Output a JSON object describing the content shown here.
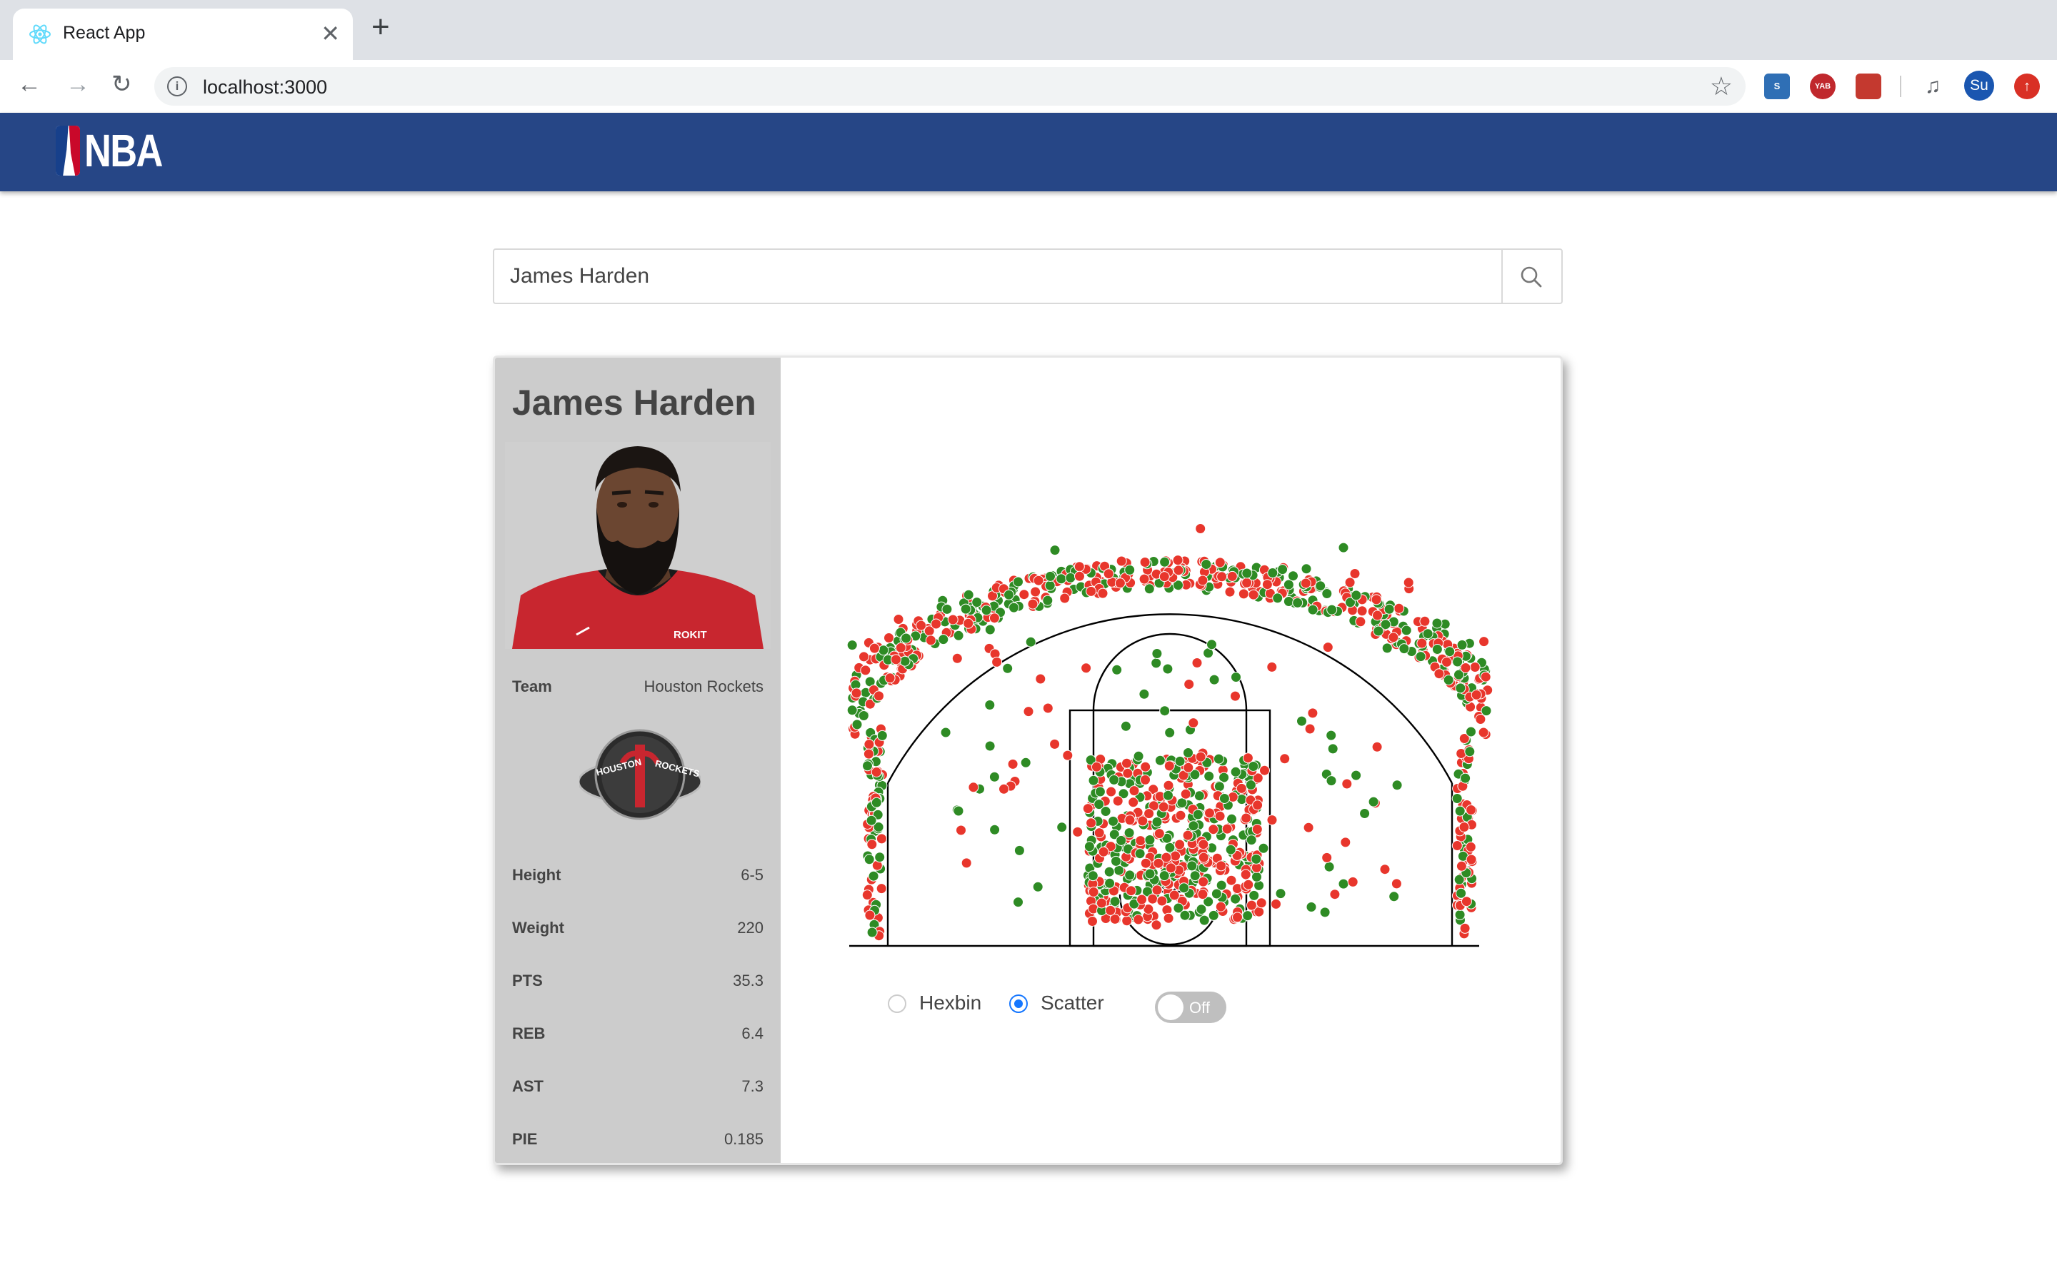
{
  "browser": {
    "tab_title": "React App",
    "tab_close": "✕",
    "new_tab": "+",
    "url": "localhost:3000",
    "nav": {
      "back": "←",
      "forward": "→",
      "reload": "↻"
    },
    "star": "☆",
    "extensions": [
      "S",
      "YAB",
      "",
      "",
      ""
    ],
    "profile": "Su"
  },
  "header": {
    "logo_text": "NBA"
  },
  "search": {
    "value": "James Harden"
  },
  "player": {
    "name": "James Harden",
    "team_label": "Team",
    "team": "Houston Rockets",
    "team_logo_text": [
      "HOUSTON",
      "ROCKETS"
    ],
    "stats": [
      {
        "label": "Height",
        "value": "6-5"
      },
      {
        "label": "Weight",
        "value": "220"
      },
      {
        "label": "PTS",
        "value": "35.3"
      },
      {
        "label": "REB",
        "value": "6.4"
      },
      {
        "label": "AST",
        "value": "7.3"
      },
      {
        "label": "PIE",
        "value": "0.185"
      }
    ]
  },
  "controls": {
    "hexbin_label": "Hexbin",
    "scatter_label": "Scatter",
    "selected": "Scatter",
    "toggle_label": "Off"
  },
  "colors": {
    "made": "#2e8b24",
    "missed": "#e8362c",
    "header": "#264686"
  }
}
